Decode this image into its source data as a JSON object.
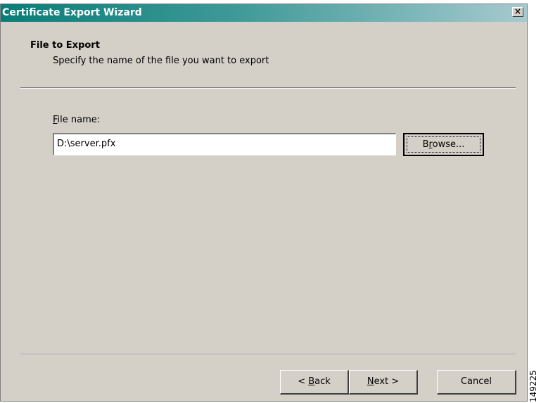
{
  "window": {
    "title": "Certificate Export Wizard",
    "close_symbol": "×"
  },
  "header": {
    "title": "File to Export",
    "subtitle": "Specify the name of the file you want to export"
  },
  "file_field": {
    "label_mnemonic": "F",
    "label_rest": "ile name:",
    "value": "D:\\server.pfx"
  },
  "buttons": {
    "browse_before": "B",
    "browse_mnemonic": "r",
    "browse_after": "owse...",
    "back_before": "< ",
    "back_mnemonic": "B",
    "back_after": "ack",
    "next_mnemonic": "N",
    "next_after": "ext >",
    "cancel": "Cancel"
  },
  "figure_id": "149225",
  "colors": {
    "titlebar_start": "#0a7c78",
    "titlebar_end": "#a6cacf",
    "dialog_bg": "#d4d0c8"
  }
}
